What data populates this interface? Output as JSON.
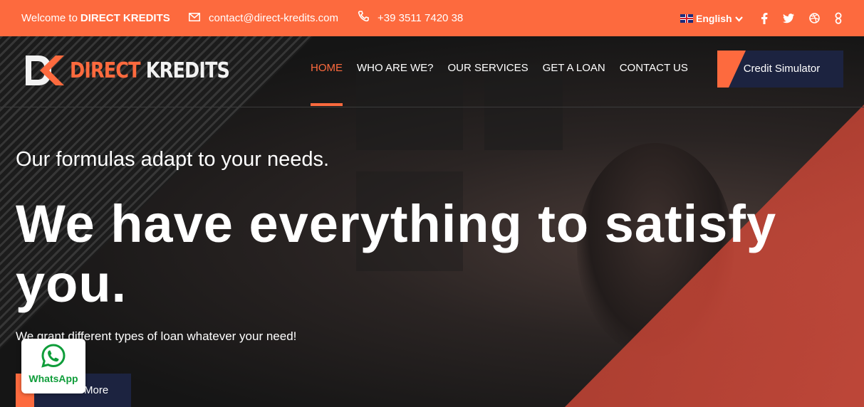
{
  "topbar": {
    "welcome_prefix": "Welcome to",
    "welcome_brand": "DIRECT KREDITS",
    "email": "contact@direct-kredits.com",
    "phone": "+39 3511 7420 38",
    "language": "English",
    "social": [
      "facebook-icon",
      "twitter-icon",
      "dribbble-icon",
      "google-icon"
    ]
  },
  "logo": {
    "part1": "DIRECT",
    "part2": "KREDITS"
  },
  "nav": {
    "items": [
      {
        "label": "HOME",
        "active": true
      },
      {
        "label": "WHO ARE WE?",
        "active": false
      },
      {
        "label": "OUR SERVICES",
        "active": false
      },
      {
        "label": "GET A LOAN",
        "active": false
      },
      {
        "label": "CONTACT US",
        "active": false
      }
    ],
    "cta": "Credit Simulator"
  },
  "hero": {
    "subtitle": "Our formulas adapt to your needs.",
    "headline": "We have everything to satisfy you.",
    "description": "We grant different types of loan whatever your need!",
    "button": "More"
  },
  "whatsapp": {
    "label": "WhatsApp"
  },
  "colors": {
    "accent": "#fd6a3e",
    "navy": "#1c2340",
    "whatsapp": "#0f9d3a"
  }
}
